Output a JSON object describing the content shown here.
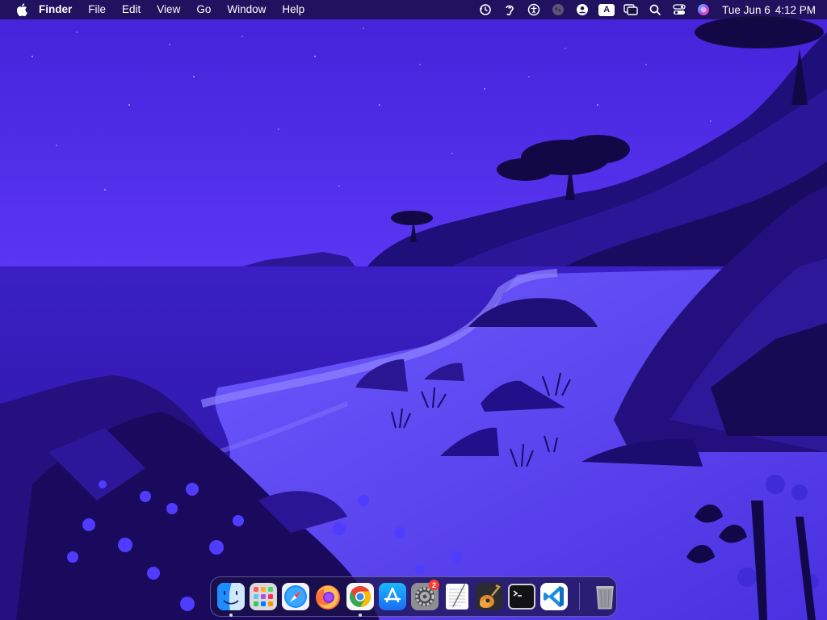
{
  "menubar": {
    "apple_icon": "apple-logo-icon",
    "app_name": "Finder",
    "menus": [
      "File",
      "Edit",
      "View",
      "Go",
      "Window",
      "Help"
    ],
    "status_icons": [
      "time-machine-icon",
      "hearing-icon",
      "accessibility-icon",
      "shazam-icon",
      "user-account-icon",
      "input-source-icon",
      "screen-mirroring-icon",
      "spotlight-search-icon",
      "control-center-icon",
      "siri-icon"
    ],
    "input_source_label": "A",
    "clock_date": "Tue Jun 6",
    "clock_time": "4:12 PM"
  },
  "dock": {
    "apps": [
      {
        "name": "Finder",
        "icon": "finder-icon",
        "running": true
      },
      {
        "name": "Launchpad",
        "icon": "launchpad-icon",
        "running": false
      },
      {
        "name": "Safari",
        "icon": "safari-icon",
        "running": false
      },
      {
        "name": "Firefox",
        "icon": "firefox-icon",
        "running": false
      },
      {
        "name": "Google Chrome",
        "icon": "chrome-icon",
        "running": true
      },
      {
        "name": "App Store",
        "icon": "app-store-icon",
        "running": false
      },
      {
        "name": "System Settings",
        "icon": "system-settings-icon",
        "running": false,
        "badge": "2"
      },
      {
        "name": "TextEdit",
        "icon": "textedit-icon",
        "running": false
      },
      {
        "name": "GarageBand",
        "icon": "garageband-icon",
        "running": false
      },
      {
        "name": "Terminal",
        "icon": "terminal-icon",
        "running": false
      },
      {
        "name": "Visual Studio Code",
        "icon": "vscode-icon",
        "running": false
      }
    ],
    "trash": {
      "name": "Trash",
      "icon": "trash-icon"
    }
  },
  "colors": {
    "sky": "#4a2ae6",
    "sea": "#3a1fc8",
    "rock": "#1f1178",
    "dark_rock": "#160c55",
    "sand": "#6a55ff",
    "menubar": "#1a1040"
  }
}
